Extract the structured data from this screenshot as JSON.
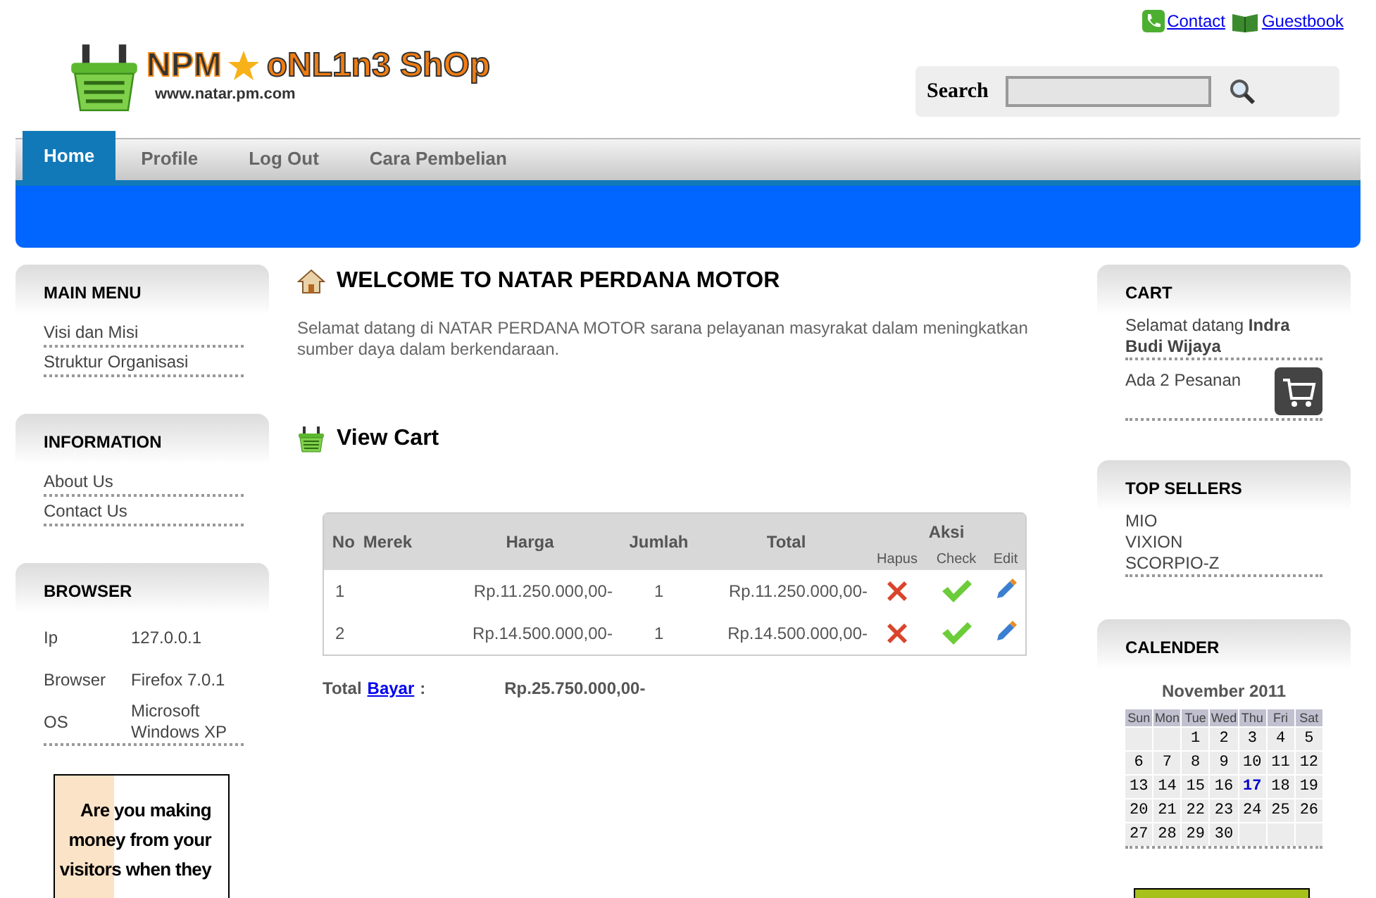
{
  "top_links": [
    {
      "kind": "phone",
      "label": "Contact"
    },
    {
      "kind": "book",
      "label": "Guestbook"
    }
  ],
  "logo": {
    "left": "NPM",
    "right": "oNL1n3 ShOp",
    "url": "www.natar.pm.com"
  },
  "search": {
    "label": "Search"
  },
  "nav": [
    {
      "label": "Home",
      "selected": true
    },
    {
      "label": "Profile",
      "selected": false
    },
    {
      "label": "Log Out",
      "selected": false
    },
    {
      "label": "Cara Pembelian",
      "selected": false
    }
  ],
  "left": {
    "main_menu": {
      "title": "MAIN MENU",
      "items": [
        "Visi dan Misi",
        "Struktur Organisasi"
      ]
    },
    "information": {
      "title": "INFORMATION",
      "items": [
        "About Us",
        "Contact Us"
      ]
    },
    "browser": {
      "title": "BROWSER",
      "rows": [
        {
          "label": "Ip",
          "value": "127.0.0.1"
        },
        {
          "label": "Browser",
          "value": "Firefox 7.0.1"
        },
        {
          "label": "OS",
          "value": "Microsoft Windows XP"
        }
      ]
    },
    "ad": {
      "lines": [
        "Are you making",
        "money from your",
        "visitors when they"
      ]
    }
  },
  "welcome": {
    "title": "WELCOME TO NATAR PERDANA MOTOR",
    "text": "Selamat datang di NATAR PERDANA MOTOR sarana pelayanan masyrakat dalam meningkatkan sumber daya dalam berkendaraan."
  },
  "cart_view": {
    "title": "View Cart",
    "columns": [
      "No",
      "Merek",
      "Harga",
      "Jumlah",
      "Total"
    ],
    "action_group": "Aksi",
    "actions": [
      "Hapus",
      "Check",
      "Edit"
    ],
    "rows": [
      {
        "no": "1",
        "harga": "Rp.11.250.000,00-",
        "jumlah": "1",
        "total": "Rp.11.250.000,00-"
      },
      {
        "no": "2",
        "harga": "Rp.14.500.000,00-",
        "jumlah": "1",
        "total": "Rp.14.500.000,00-"
      }
    ],
    "total_label": "Total",
    "pay_link": "Bayar",
    "colon": ":",
    "total_value": "Rp.25.750.000,00-"
  },
  "right": {
    "cart": {
      "title": "CART",
      "greeting": "Selamat datang **Indra Budi Wijaya**",
      "orders": "Ada 2 Pesanan"
    },
    "top_sellers": {
      "title": "TOP SELLERS",
      "items": [
        "MIO",
        "VIXION",
        "SCORPIO-Z"
      ]
    },
    "calendar": {
      "title": "CALENDER",
      "month": "November 2011",
      "weekdays": [
        "Sun",
        "Mon",
        "Tue",
        "Wed",
        "Thu",
        "Fri",
        "Sat"
      ],
      "weeks": [
        [
          {
            "kind": "blank"
          },
          {
            "kind": "blank"
          },
          {
            "kind": "day",
            "day": "1",
            "today": false
          },
          {
            "kind": "day",
            "day": "2",
            "today": false
          },
          {
            "kind": "day",
            "day": "3",
            "today": false
          },
          {
            "kind": "day",
            "day": "4",
            "today": false
          },
          {
            "kind": "day",
            "day": "5",
            "today": false
          }
        ],
        [
          {
            "kind": "day",
            "day": "6",
            "today": false
          },
          {
            "kind": "day",
            "day": "7",
            "today": false
          },
          {
            "kind": "day",
            "day": "8",
            "today": false
          },
          {
            "kind": "day",
            "day": "9",
            "today": false
          },
          {
            "kind": "day",
            "day": "10",
            "today": false
          },
          {
            "kind": "day",
            "day": "11",
            "today": false
          },
          {
            "kind": "day",
            "day": "12",
            "today": false
          }
        ],
        [
          {
            "kind": "day",
            "day": "13",
            "today": false
          },
          {
            "kind": "day",
            "day": "14",
            "today": false
          },
          {
            "kind": "day",
            "day": "15",
            "today": false
          },
          {
            "kind": "day",
            "day": "16",
            "today": false
          },
          {
            "kind": "day",
            "day": "17",
            "today": true
          },
          {
            "kind": "day",
            "day": "18",
            "today": false
          },
          {
            "kind": "day",
            "day": "19",
            "today": false
          }
        ],
        [
          {
            "kind": "day",
            "day": "20",
            "today": false
          },
          {
            "kind": "day",
            "day": "21",
            "today": false
          },
          {
            "kind": "day",
            "day": "22",
            "today": false
          },
          {
            "kind": "day",
            "day": "23",
            "today": false
          },
          {
            "kind": "day",
            "day": "24",
            "today": false
          },
          {
            "kind": "day",
            "day": "25",
            "today": false
          },
          {
            "kind": "day",
            "day": "26",
            "today": false
          }
        ],
        [
          {
            "kind": "day",
            "day": "27",
            "today": false
          },
          {
            "kind": "day",
            "day": "28",
            "today": false
          },
          {
            "kind": "day",
            "day": "29",
            "today": false
          },
          {
            "kind": "day",
            "day": "30",
            "today": false
          },
          {
            "kind": "blank"
          },
          {
            "kind": "blank"
          },
          {
            "kind": "blank"
          }
        ]
      ]
    }
  }
}
